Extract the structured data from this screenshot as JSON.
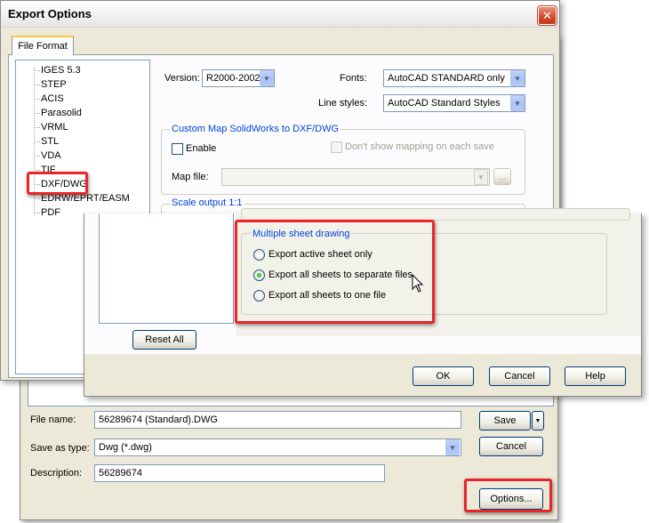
{
  "save_dialog": {
    "file_name_label": "File name:",
    "file_name_value": "56289674 (Standard).DWG",
    "save_as_type_label": "Save as type:",
    "save_as_type_value": "Dwg (*.dwg)",
    "description_label": "Description:",
    "description_value": "56289674",
    "save_button": "Save",
    "cancel_button": "Cancel",
    "options_button": "Options..."
  },
  "export_options": {
    "title": "Export Options",
    "tab_label": "File Format",
    "tree_items": [
      "IGES 5.3",
      "STEP",
      "ACIS",
      "Parasolid",
      "VRML",
      "STL",
      "VDA",
      "TIF",
      "DXF/DWG",
      "EDRW/EPRT/EASM",
      "PDF"
    ],
    "selected_item": "DXF/DWG",
    "version_label": "Version:",
    "version_value": "R2000-2002",
    "fonts_label": "Fonts:",
    "fonts_value": "AutoCAD STANDARD only",
    "line_styles_label": "Line styles:",
    "line_styles_value": "AutoCAD Standard Styles",
    "custom_map_title": "Custom Map SolidWorks to DXF/DWG",
    "enable_label": "Enable",
    "enable_checked": false,
    "dont_show_label": "Don't show mapping on each save",
    "map_file_label": "Map file:",
    "map_file_value": "",
    "browse_label": "...",
    "scale_output_title": "Scale output 1:1"
  },
  "options_dialog": {
    "multi_sheet_title": "Multiple sheet drawing",
    "radio_options": [
      "Export active sheet only",
      "Export all sheets to separate files",
      "Export all sheets to one file"
    ],
    "selected_option": "Export all sheets to separate files",
    "reset_all_button": "Reset All",
    "ok_button": "OK",
    "cancel_button": "Cancel",
    "help_button": "Help"
  },
  "colors": {
    "highlight_red": "#e8252a",
    "group_title_blue": "#0046d5",
    "dialog_bg": "#ece9d8"
  },
  "icons": [
    "close-icon",
    "dropdown-arrow-icon",
    "mouse-cursor-icon"
  ]
}
